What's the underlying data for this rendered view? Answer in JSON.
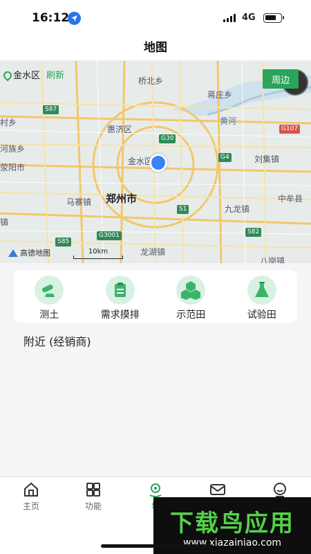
{
  "status_bar": {
    "time": "16:12",
    "network": "4G"
  },
  "nav": {
    "title": "地图"
  },
  "map": {
    "location_name": "金水区",
    "refresh_label": "刷新",
    "nearby_button": "周边",
    "scale_label": "10km",
    "provider": "高德地图",
    "labels": {
      "qiaobei": "桥北乡",
      "jiangzhuang": "蒋庄乡",
      "cun": "村乡",
      "huihe": "惠济区",
      "huanghe": "黄河",
      "hezu": "河族乡",
      "liuji": "刘集镇",
      "xingyang": "荥阳市",
      "jinshui": "金水区",
      "majia": "马寨镇",
      "zhengzhou": "郑州市",
      "zhongmou": "中牟县",
      "jiulong": "九龙镇",
      "zhen": "镇",
      "longhu": "龙湖镇",
      "bagang": "八岗镇"
    },
    "shields": {
      "s87": "S87",
      "g30": "G30",
      "g4": "G4",
      "g107": "G107",
      "s1": "S1",
      "s82": "S82",
      "s85": "S85",
      "g3001": "G3001"
    }
  },
  "features": [
    {
      "label": "测土",
      "icon": "soil-test-icon"
    },
    {
      "label": "需求摸排",
      "icon": "clipboard-icon"
    },
    {
      "label": "示范田",
      "icon": "demo-field-icon"
    },
    {
      "label": "试验田",
      "icon": "flask-icon"
    }
  ],
  "section": {
    "nearby_title": "附近 (经销商)"
  },
  "tabs": [
    {
      "label": "主页",
      "icon": "home-icon"
    },
    {
      "label": "功能",
      "icon": "grid-icon"
    },
    {
      "label": "地",
      "icon": "location-icon"
    },
    {
      "label": "",
      "icon": "mail-icon"
    },
    {
      "label": "",
      "icon": "profile-icon"
    }
  ],
  "watermark": {
    "title": "下载鸟应用",
    "url": "www.xiazainiao.com"
  },
  "colors": {
    "accent": "#2aa45a",
    "map_bg": "#e7ecea",
    "user_dot": "#3b82f6"
  }
}
